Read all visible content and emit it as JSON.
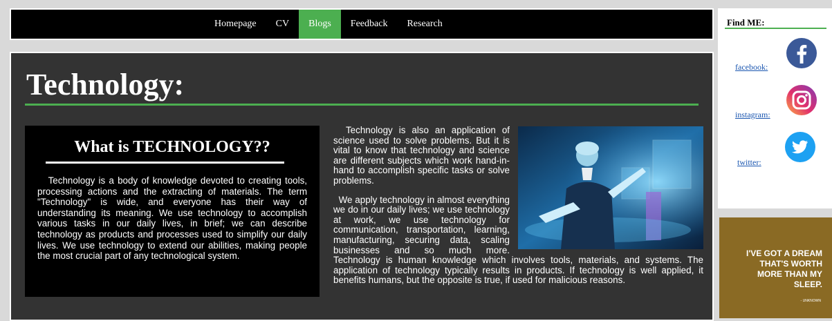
{
  "nav": {
    "items": [
      {
        "label": "Homepage"
      },
      {
        "label": "CV"
      },
      {
        "label": "Blogs",
        "active": true
      },
      {
        "label": "Feedback"
      },
      {
        "label": "Research"
      }
    ]
  },
  "main": {
    "title": "Technology:",
    "what": {
      "heading": "What is TECHNOLOGY??",
      "text": "   Technology is a body of knowledge devoted to creating tools, processing actions and the extracting of materials. The term \"Technology\" is wide, and everyone has their way of understanding its meaning. We use technology to accomplish various tasks in our daily lives, in brief; we can describe technology as products and processes used to simplify our daily lives. We use technology to extend our abilities, making people the most crucial part of any technological system."
    },
    "paragraph1": "  Technology is also an application of science used to solve problems. But it is vital to know that technology and science are different subjects which work hand-in-hand to accomplish specific tasks or solve problems.",
    "paragraph2": "  We apply technology in almost everything we do in our daily lives; we use technology at work, we use technology for communication, transportation, learning, manufacturing, securing data, scaling businesses and so much more. Technology is human knowledge which involves tools, materials, and systems. The application of technology typically results in products. If technology is well applied, it benefits humans, but the opposite is true, if used for malicious reasons."
  },
  "sidebar": {
    "title": "Find ME:",
    "links": [
      {
        "label": "facebook:",
        "icon": "facebook-icon"
      },
      {
        "label": "instagram:",
        "icon": "instagram-icon"
      },
      {
        "label": "twitter:",
        "icon": "twitter-icon"
      }
    ],
    "poster": {
      "text": "I'VE GOT A DREAM THAT'S WORTH MORE THAN MY SLEEP.",
      "author": "- UNKNOWN"
    }
  },
  "colors": {
    "accent": "#4caf50",
    "panel": "#333333",
    "nav": "#000000"
  }
}
